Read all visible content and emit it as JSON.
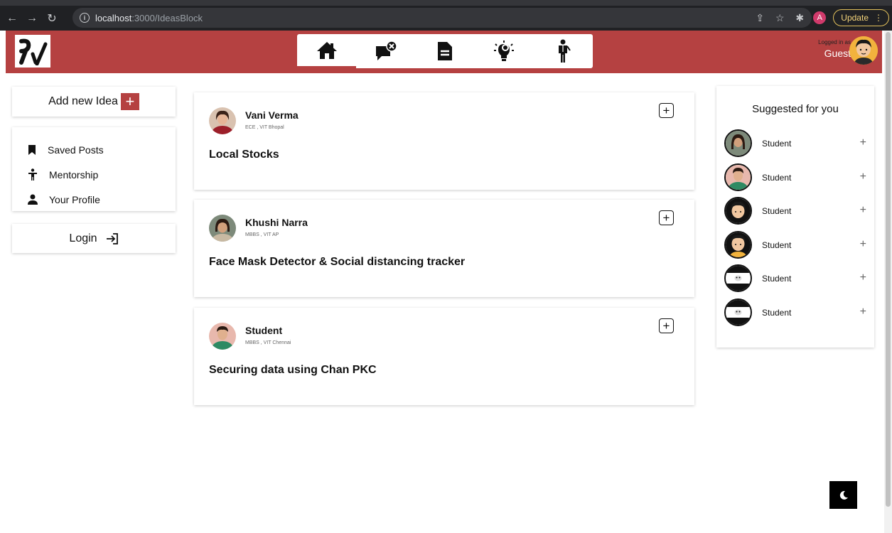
{
  "browser": {
    "url_host": "localhost",
    "url_path": ":3000/IdeasBlock",
    "profile_initial": "A",
    "update_label": "Update"
  },
  "header": {
    "nav": [
      {
        "icon": "home-icon",
        "active": true
      },
      {
        "icon": "chat-icon",
        "active": false
      },
      {
        "icon": "document-icon",
        "active": false
      },
      {
        "icon": "lightbulb-icon",
        "active": false
      },
      {
        "icon": "mentor-icon",
        "active": false
      }
    ],
    "logged_in_label": "Logged in as",
    "user_name": "Guest",
    "accent_color": "#b54141"
  },
  "sidebar": {
    "add_idea_label": "Add new Idea",
    "add_idea_plus": "+",
    "items": [
      {
        "label": "Saved Posts",
        "icon": "bookmark-icon"
      },
      {
        "label": "Mentorship",
        "icon": "person-standing-icon"
      },
      {
        "label": "Your Profile",
        "icon": "user-icon"
      }
    ],
    "login_label": "Login"
  },
  "posts": [
    {
      "author": "Vani Verma",
      "subtitle": "ECE , VIT Bhopal",
      "title": "Local Stocks",
      "add": "+"
    },
    {
      "author": "Khushi Narra",
      "subtitle": "MBBS , VIT AP",
      "title": "Face Mask Detector & Social distancing tracker",
      "add": "+"
    },
    {
      "author": "Student",
      "subtitle": "MBBS , VIT Chennai",
      "title": "Securing data using Chan PKC",
      "add": "+"
    }
  ],
  "suggested": {
    "title": "Suggested for you",
    "people": [
      {
        "name": "Student",
        "plus": "+"
      },
      {
        "name": "Student",
        "plus": "+"
      },
      {
        "name": "Student",
        "plus": "+"
      },
      {
        "name": "Student",
        "plus": "+"
      },
      {
        "name": "Student",
        "plus": "+"
      },
      {
        "name": "Student",
        "plus": "+"
      }
    ]
  }
}
